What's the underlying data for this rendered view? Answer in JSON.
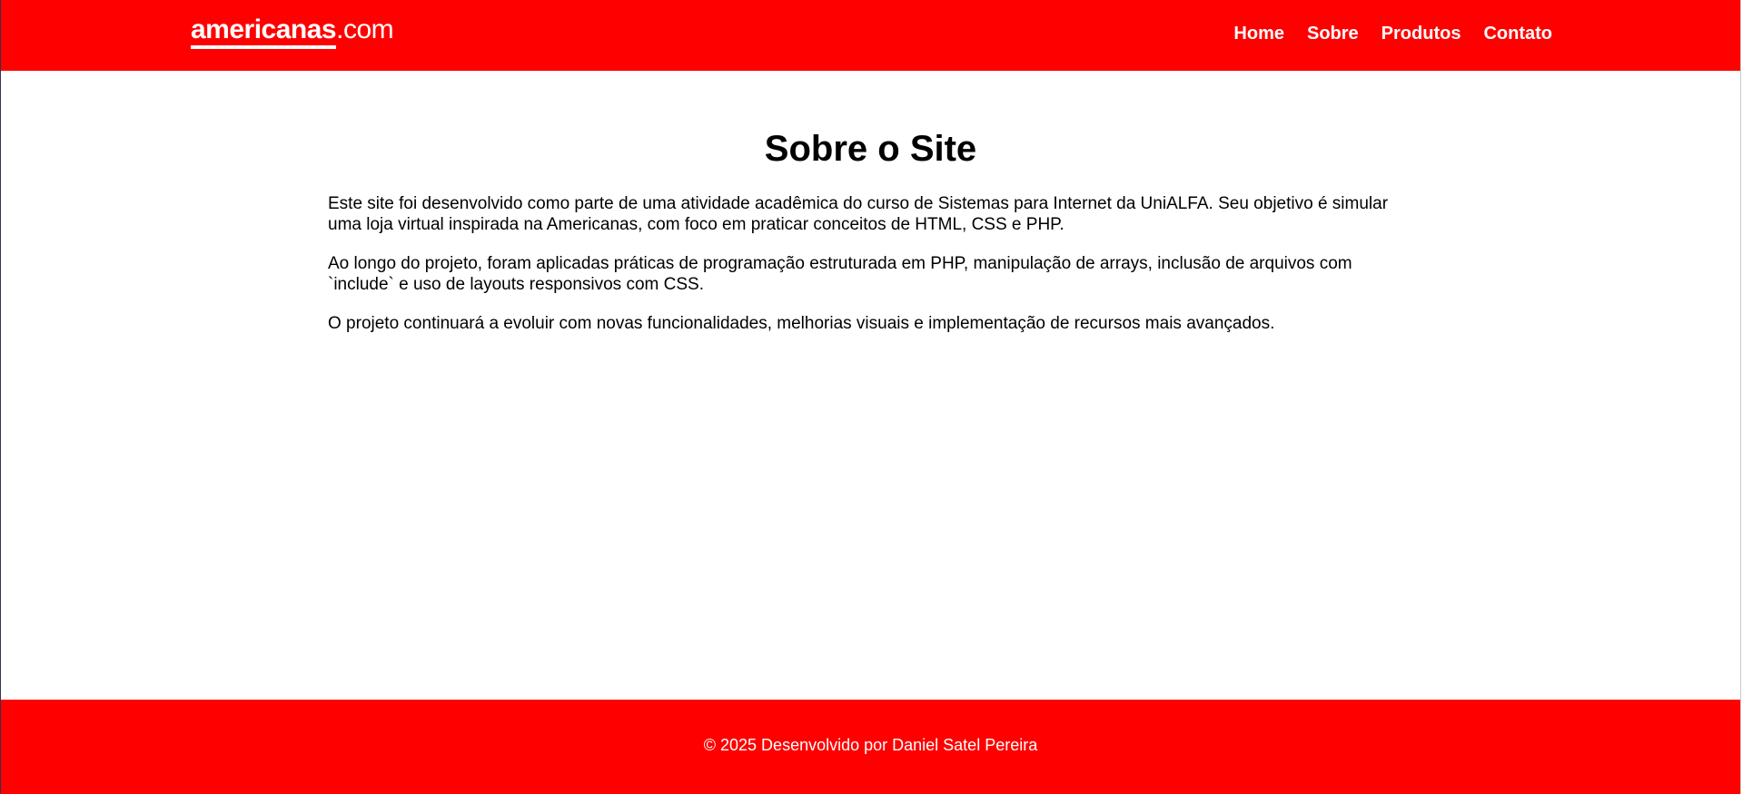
{
  "colors": {
    "brand_red": "#ff0000",
    "text": "#000000",
    "header_text": "#ffffff"
  },
  "header": {
    "logo_word": "americanas",
    "logo_tld": ".com",
    "nav": [
      {
        "label": "Home"
      },
      {
        "label": "Sobre"
      },
      {
        "label": "Produtos"
      },
      {
        "label": "Contato"
      }
    ]
  },
  "main": {
    "title": "Sobre o Site",
    "paragraphs": [
      "Este site foi desenvolvido como parte de uma atividade acadêmica do curso de Sistemas para Internet da UniALFA. Seu objetivo é simular uma loja virtual inspirada na Americanas, com foco em praticar conceitos de HTML, CSS e PHP.",
      "Ao longo do projeto, foram aplicadas práticas de programação estruturada em PHP, manipulação de arrays, inclusão de arquivos com `include` e uso de layouts responsivos com CSS.",
      "O projeto continuará a evoluir com novas funcionalidades, melhorias visuais e implementação de recursos mais avançados."
    ]
  },
  "footer": {
    "copyright": "© 2025 Desenvolvido por Daniel Satel Pereira"
  }
}
